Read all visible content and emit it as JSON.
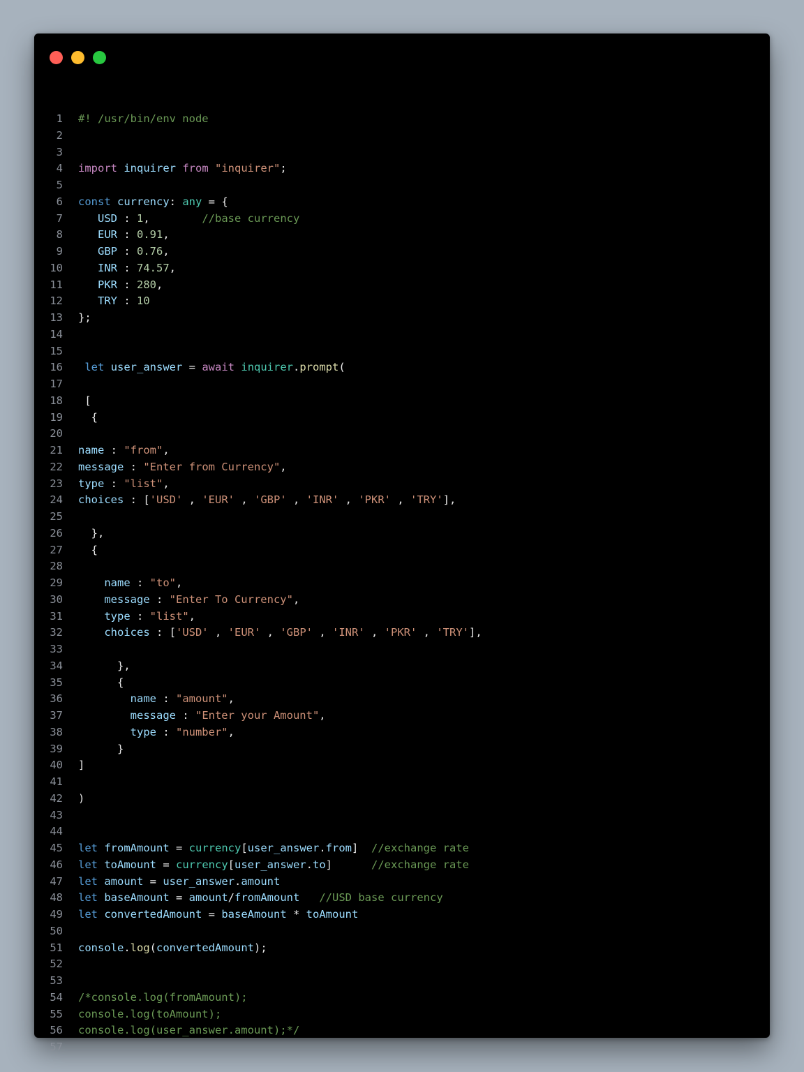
{
  "window": {
    "controls": [
      {
        "name": "close",
        "color": "#ff5f57"
      },
      {
        "name": "minimize",
        "color": "#febc2e"
      },
      {
        "name": "maximize",
        "color": "#28c840"
      }
    ]
  },
  "colors": {
    "p": "#e8e8e8",
    "c": "#6a9955",
    "k": "#c586c0",
    "b": "#569cd6",
    "s": "#ce9178",
    "v": "#9cdcfe",
    "t": "#4ec9b0",
    "n": "#b5cea8",
    "f": "#dcdcaa"
  },
  "lines": [
    {
      "n": "1",
      "tokens": [
        [
          "c",
          "#! /usr/bin/env node"
        ]
      ]
    },
    {
      "n": "2",
      "tokens": []
    },
    {
      "n": "3",
      "tokens": []
    },
    {
      "n": "4",
      "tokens": [
        [
          "k",
          "import"
        ],
        [
          "p",
          " "
        ],
        [
          "v",
          "inquirer"
        ],
        [
          "p",
          " "
        ],
        [
          "k",
          "from"
        ],
        [
          "p",
          " "
        ],
        [
          "s",
          "\"inquirer\""
        ],
        [
          "p",
          ";"
        ]
      ]
    },
    {
      "n": "5",
      "tokens": []
    },
    {
      "n": "6",
      "tokens": [
        [
          "b",
          "const"
        ],
        [
          "p",
          " "
        ],
        [
          "v",
          "currency"
        ],
        [
          "p",
          ": "
        ],
        [
          "t",
          "any"
        ],
        [
          "p",
          " = {"
        ]
      ]
    },
    {
      "n": "7",
      "tokens": [
        [
          "p",
          "   "
        ],
        [
          "v",
          "USD"
        ],
        [
          "p",
          " : "
        ],
        [
          "n",
          "1"
        ],
        [
          "p",
          ",        "
        ],
        [
          "c",
          "//base currency"
        ]
      ]
    },
    {
      "n": "8",
      "tokens": [
        [
          "p",
          "   "
        ],
        [
          "v",
          "EUR"
        ],
        [
          "p",
          " : "
        ],
        [
          "n",
          "0.91"
        ],
        [
          "p",
          ","
        ]
      ]
    },
    {
      "n": "9",
      "tokens": [
        [
          "p",
          "   "
        ],
        [
          "v",
          "GBP"
        ],
        [
          "p",
          " : "
        ],
        [
          "n",
          "0.76"
        ],
        [
          "p",
          ","
        ]
      ]
    },
    {
      "n": "10",
      "tokens": [
        [
          "p",
          "   "
        ],
        [
          "v",
          "INR"
        ],
        [
          "p",
          " : "
        ],
        [
          "n",
          "74.57"
        ],
        [
          "p",
          ","
        ]
      ]
    },
    {
      "n": "11",
      "tokens": [
        [
          "p",
          "   "
        ],
        [
          "v",
          "PKR"
        ],
        [
          "p",
          " : "
        ],
        [
          "n",
          "280"
        ],
        [
          "p",
          ","
        ]
      ]
    },
    {
      "n": "12",
      "tokens": [
        [
          "p",
          "   "
        ],
        [
          "v",
          "TRY"
        ],
        [
          "p",
          " : "
        ],
        [
          "n",
          "10"
        ]
      ]
    },
    {
      "n": "13",
      "tokens": [
        [
          "p",
          "};"
        ]
      ]
    },
    {
      "n": "14",
      "tokens": []
    },
    {
      "n": "15",
      "tokens": []
    },
    {
      "n": "16",
      "tokens": [
        [
          "p",
          " "
        ],
        [
          "b",
          "let"
        ],
        [
          "p",
          " "
        ],
        [
          "v",
          "user_answer"
        ],
        [
          "p",
          " = "
        ],
        [
          "k",
          "await"
        ],
        [
          "p",
          " "
        ],
        [
          "t",
          "inquirer"
        ],
        [
          "p",
          "."
        ],
        [
          "f",
          "prompt"
        ],
        [
          "p",
          "("
        ]
      ]
    },
    {
      "n": "17",
      "tokens": []
    },
    {
      "n": "18",
      "tokens": [
        [
          "p",
          " ["
        ]
      ]
    },
    {
      "n": "19",
      "tokens": [
        [
          "p",
          "  {"
        ]
      ]
    },
    {
      "n": "20",
      "tokens": []
    },
    {
      "n": "21",
      "tokens": [
        [
          "v",
          "name"
        ],
        [
          "p",
          " : "
        ],
        [
          "s",
          "\"from\""
        ],
        [
          "p",
          ","
        ]
      ]
    },
    {
      "n": "22",
      "tokens": [
        [
          "v",
          "message"
        ],
        [
          "p",
          " : "
        ],
        [
          "s",
          "\"Enter from Currency\""
        ],
        [
          "p",
          ","
        ]
      ]
    },
    {
      "n": "23",
      "tokens": [
        [
          "v",
          "type"
        ],
        [
          "p",
          " : "
        ],
        [
          "s",
          "\"list\""
        ],
        [
          "p",
          ","
        ]
      ]
    },
    {
      "n": "24",
      "tokens": [
        [
          "v",
          "choices"
        ],
        [
          "p",
          " : ["
        ],
        [
          "s",
          "'USD'"
        ],
        [
          "p",
          " , "
        ],
        [
          "s",
          "'EUR'"
        ],
        [
          "p",
          " , "
        ],
        [
          "s",
          "'GBP'"
        ],
        [
          "p",
          " , "
        ],
        [
          "s",
          "'INR'"
        ],
        [
          "p",
          " , "
        ],
        [
          "s",
          "'PKR'"
        ],
        [
          "p",
          " , "
        ],
        [
          "s",
          "'TRY'"
        ],
        [
          "p",
          "],"
        ]
      ]
    },
    {
      "n": "25",
      "tokens": []
    },
    {
      "n": "26",
      "tokens": [
        [
          "p",
          "  },"
        ]
      ]
    },
    {
      "n": "27",
      "tokens": [
        [
          "p",
          "  {"
        ]
      ]
    },
    {
      "n": "28",
      "tokens": []
    },
    {
      "n": "29",
      "tokens": [
        [
          "p",
          "    "
        ],
        [
          "v",
          "name"
        ],
        [
          "p",
          " : "
        ],
        [
          "s",
          "\"to\""
        ],
        [
          "p",
          ","
        ]
      ]
    },
    {
      "n": "30",
      "tokens": [
        [
          "p",
          "    "
        ],
        [
          "v",
          "message"
        ],
        [
          "p",
          " : "
        ],
        [
          "s",
          "\"Enter To Currency\""
        ],
        [
          "p",
          ","
        ]
      ]
    },
    {
      "n": "31",
      "tokens": [
        [
          "p",
          "    "
        ],
        [
          "v",
          "type"
        ],
        [
          "p",
          " : "
        ],
        [
          "s",
          "\"list\""
        ],
        [
          "p",
          ","
        ]
      ]
    },
    {
      "n": "32",
      "tokens": [
        [
          "p",
          "    "
        ],
        [
          "v",
          "choices"
        ],
        [
          "p",
          " : ["
        ],
        [
          "s",
          "'USD'"
        ],
        [
          "p",
          " , "
        ],
        [
          "s",
          "'EUR'"
        ],
        [
          "p",
          " , "
        ],
        [
          "s",
          "'GBP'"
        ],
        [
          "p",
          " , "
        ],
        [
          "s",
          "'INR'"
        ],
        [
          "p",
          " , "
        ],
        [
          "s",
          "'PKR'"
        ],
        [
          "p",
          " , "
        ],
        [
          "s",
          "'TRY'"
        ],
        [
          "p",
          "],"
        ]
      ]
    },
    {
      "n": "33",
      "tokens": []
    },
    {
      "n": "34",
      "tokens": [
        [
          "p",
          "      },"
        ]
      ]
    },
    {
      "n": "35",
      "tokens": [
        [
          "p",
          "      {"
        ]
      ]
    },
    {
      "n": "36",
      "tokens": [
        [
          "p",
          "        "
        ],
        [
          "v",
          "name"
        ],
        [
          "p",
          " : "
        ],
        [
          "s",
          "\"amount\""
        ],
        [
          "p",
          ","
        ]
      ]
    },
    {
      "n": "37",
      "tokens": [
        [
          "p",
          "        "
        ],
        [
          "v",
          "message"
        ],
        [
          "p",
          " : "
        ],
        [
          "s",
          "\"Enter your Amount\""
        ],
        [
          "p",
          ","
        ]
      ]
    },
    {
      "n": "38",
      "tokens": [
        [
          "p",
          "        "
        ],
        [
          "v",
          "type"
        ],
        [
          "p",
          " : "
        ],
        [
          "s",
          "\"number\""
        ],
        [
          "p",
          ","
        ]
      ]
    },
    {
      "n": "39",
      "tokens": [
        [
          "p",
          "      }"
        ]
      ]
    },
    {
      "n": "40",
      "tokens": [
        [
          "p",
          "]"
        ]
      ]
    },
    {
      "n": "41",
      "tokens": []
    },
    {
      "n": "42",
      "tokens": [
        [
          "p",
          ")"
        ]
      ]
    },
    {
      "n": "43",
      "tokens": []
    },
    {
      "n": "44",
      "tokens": []
    },
    {
      "n": "45",
      "tokens": [
        [
          "b",
          "let"
        ],
        [
          "p",
          " "
        ],
        [
          "v",
          "fromAmount"
        ],
        [
          "p",
          " = "
        ],
        [
          "t",
          "currency"
        ],
        [
          "p",
          "["
        ],
        [
          "v",
          "user_answer"
        ],
        [
          "p",
          "."
        ],
        [
          "v",
          "from"
        ],
        [
          "p",
          "]  "
        ],
        [
          "c",
          "//exchange rate"
        ]
      ]
    },
    {
      "n": "46",
      "tokens": [
        [
          "b",
          "let"
        ],
        [
          "p",
          " "
        ],
        [
          "v",
          "toAmount"
        ],
        [
          "p",
          " = "
        ],
        [
          "t",
          "currency"
        ],
        [
          "p",
          "["
        ],
        [
          "v",
          "user_answer"
        ],
        [
          "p",
          "."
        ],
        [
          "v",
          "to"
        ],
        [
          "p",
          "]      "
        ],
        [
          "c",
          "//exchange rate"
        ]
      ]
    },
    {
      "n": "47",
      "tokens": [
        [
          "b",
          "let"
        ],
        [
          "p",
          " "
        ],
        [
          "v",
          "amount"
        ],
        [
          "p",
          " = "
        ],
        [
          "v",
          "user_answer"
        ],
        [
          "p",
          "."
        ],
        [
          "v",
          "amount"
        ]
      ]
    },
    {
      "n": "48",
      "tokens": [
        [
          "b",
          "let"
        ],
        [
          "p",
          " "
        ],
        [
          "v",
          "baseAmount"
        ],
        [
          "p",
          " = "
        ],
        [
          "v",
          "amount"
        ],
        [
          "p",
          "/"
        ],
        [
          "v",
          "fromAmount"
        ],
        [
          "p",
          "   "
        ],
        [
          "c",
          "//USD base currency"
        ]
      ]
    },
    {
      "n": "49",
      "tokens": [
        [
          "b",
          "let"
        ],
        [
          "p",
          " "
        ],
        [
          "v",
          "convertedAmount"
        ],
        [
          "p",
          " = "
        ],
        [
          "v",
          "baseAmount"
        ],
        [
          "p",
          " * "
        ],
        [
          "v",
          "toAmount"
        ]
      ]
    },
    {
      "n": "50",
      "tokens": []
    },
    {
      "n": "51",
      "tokens": [
        [
          "v",
          "console"
        ],
        [
          "p",
          "."
        ],
        [
          "f",
          "log"
        ],
        [
          "p",
          "("
        ],
        [
          "v",
          "convertedAmount"
        ],
        [
          "p",
          ");"
        ]
      ]
    },
    {
      "n": "52",
      "tokens": []
    },
    {
      "n": "53",
      "tokens": []
    },
    {
      "n": "54",
      "tokens": [
        [
          "c",
          "/*console.log(fromAmount);"
        ]
      ]
    },
    {
      "n": "55",
      "tokens": [
        [
          "c",
          "console.log(toAmount);"
        ]
      ]
    },
    {
      "n": "56",
      "tokens": [
        [
          "c",
          "console.log(user_answer.amount);*/"
        ]
      ]
    },
    {
      "n": "57",
      "tokens": []
    }
  ]
}
